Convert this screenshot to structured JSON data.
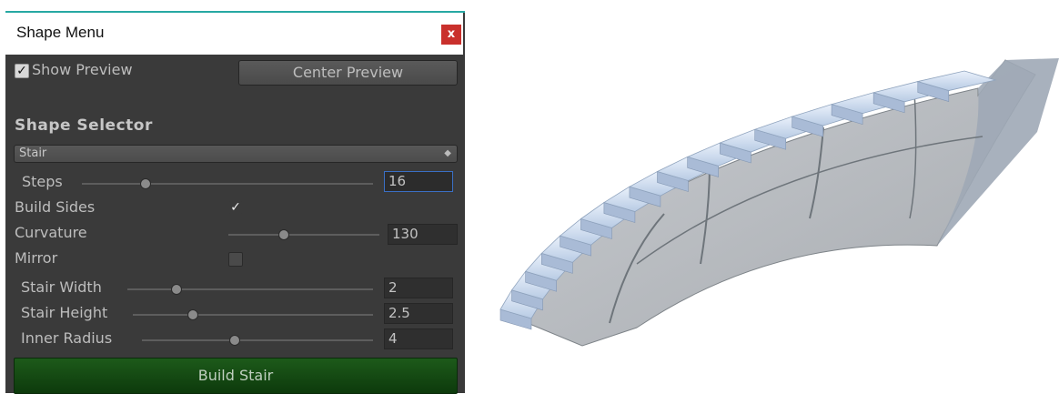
{
  "window": {
    "title": "Shape Menu",
    "close_label": "x"
  },
  "preview_toggle": {
    "label": "Show Preview",
    "checked": true
  },
  "center_preview_button": {
    "label": "Center Preview"
  },
  "shape_selector": {
    "heading": "Shape Selector",
    "selected": "Stair"
  },
  "params": {
    "steps": {
      "label": "Steps",
      "value": "16",
      "fraction": 0.22
    },
    "build_sides": {
      "label": "Build Sides",
      "checked": true
    },
    "curvature": {
      "label": "Curvature",
      "value": "130",
      "fraction": 0.37
    },
    "mirror": {
      "label": "Mirror",
      "checked": false
    },
    "stair_width": {
      "label": "Stair Width",
      "value": "2",
      "fraction": 0.2
    },
    "stair_height": {
      "label": "Stair Height",
      "value": "2.5",
      "fraction": 0.25
    },
    "inner_radius": {
      "label": "Inner Radius",
      "value": "4",
      "fraction": 0.4
    }
  },
  "build_button": {
    "label": "Build Stair"
  },
  "colors": {
    "title_accent": "#27a8a3",
    "close": "#c9302c",
    "build": "#1d5a1a",
    "focus": "#3a6fc4"
  }
}
